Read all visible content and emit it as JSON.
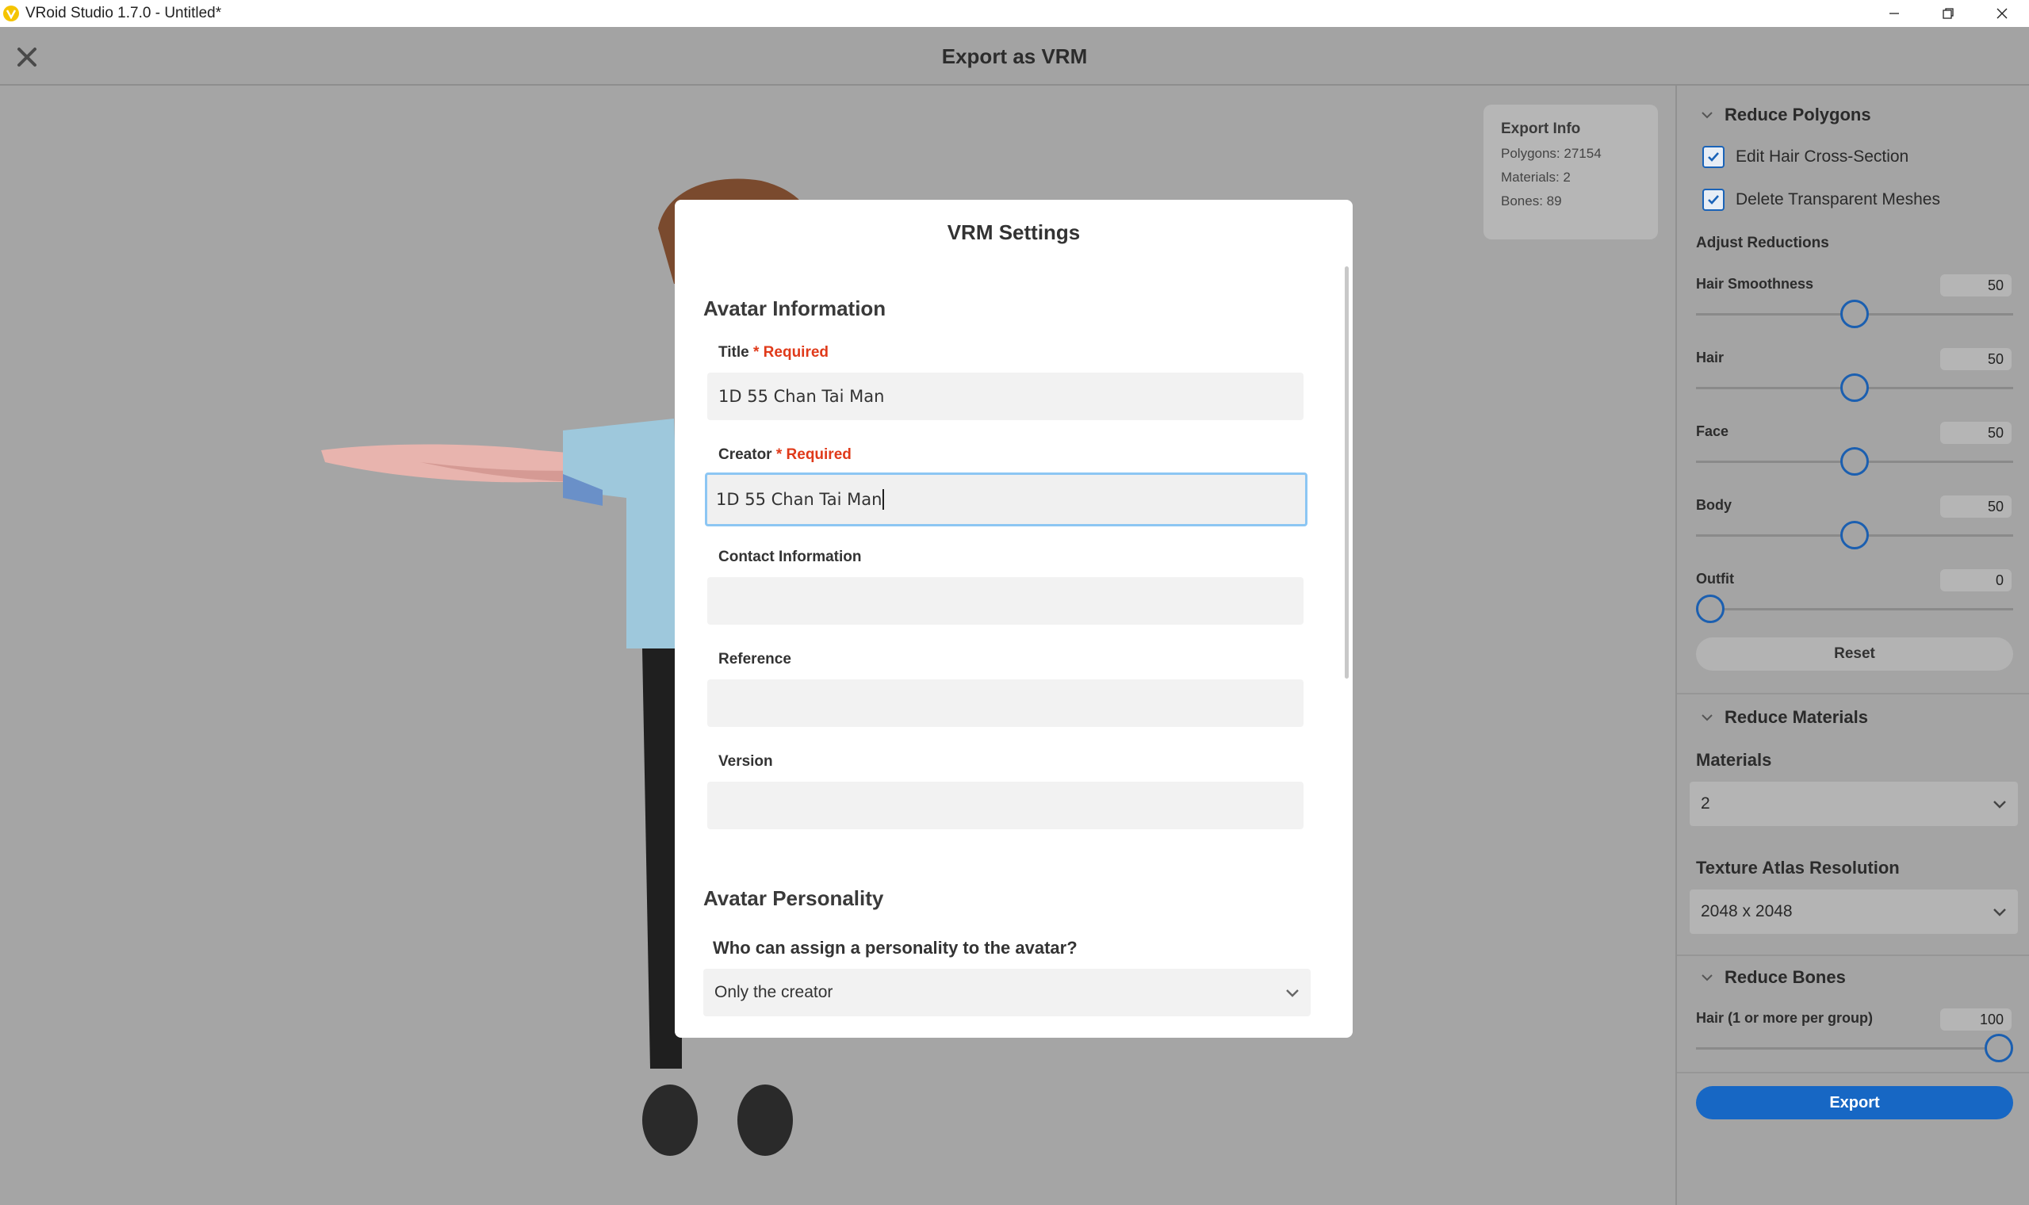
{
  "window": {
    "title": "VRoid Studio 1.7.0 - Untitled*",
    "controls": [
      "minimize-icon",
      "restore-icon",
      "close-icon"
    ]
  },
  "header": {
    "title": "Export as VRM"
  },
  "export_info": {
    "title": "Export Info",
    "polygons": "Polygons: 27154",
    "materials": "Materials: 2",
    "bones": "Bones: 89"
  },
  "panel": {
    "reduce_polygons": {
      "title": "Reduce Polygons",
      "edit_hair_cross_section": {
        "label": "Edit Hair Cross-Section",
        "checked": true
      },
      "delete_transparent_meshes": {
        "label": "Delete Transparent Meshes",
        "checked": true
      },
      "adjust_reductions": "Adjust Reductions",
      "sliders": [
        {
          "label": "Hair Smoothness",
          "value": "50",
          "fraction": 0.5
        },
        {
          "label": "Hair",
          "value": "50",
          "fraction": 0.5
        },
        {
          "label": "Face",
          "value": "50",
          "fraction": 0.5
        },
        {
          "label": "Body",
          "value": "50",
          "fraction": 0.5
        },
        {
          "label": "Outfit",
          "value": "0",
          "fraction": 0.0
        }
      ],
      "reset": "Reset"
    },
    "reduce_materials": {
      "title": "Reduce Materials",
      "materials_label": "Materials",
      "materials_value": "2",
      "atlas_label": "Texture Atlas Resolution",
      "atlas_value": "2048 x 2048"
    },
    "reduce_bones": {
      "title": "Reduce Bones",
      "hair_label": "Hair (1 or more per group)",
      "hair_value": "100",
      "hair_fraction": 1.0
    },
    "export": "Export"
  },
  "modal": {
    "title": "VRM Settings",
    "avatar_information": "Avatar Information",
    "required_text": "* Required",
    "fields": {
      "title": {
        "label": "Title",
        "value": "1D 55 Chan Tai Man"
      },
      "creator": {
        "label": "Creator",
        "value": "1D 55 Chan Tai Man"
      },
      "contact": {
        "label": "Contact Information",
        "value": ""
      },
      "reference": {
        "label": "Reference",
        "value": ""
      },
      "version": {
        "label": "Version",
        "value": ""
      }
    },
    "avatar_personality": "Avatar Personality",
    "personality_question": "Who can assign a personality to the avatar?",
    "personality_value": "Only the creator"
  },
  "colors": {
    "accent": "#1767c4",
    "required": "#e03a1a",
    "focus_border": "#8cc6f3"
  }
}
